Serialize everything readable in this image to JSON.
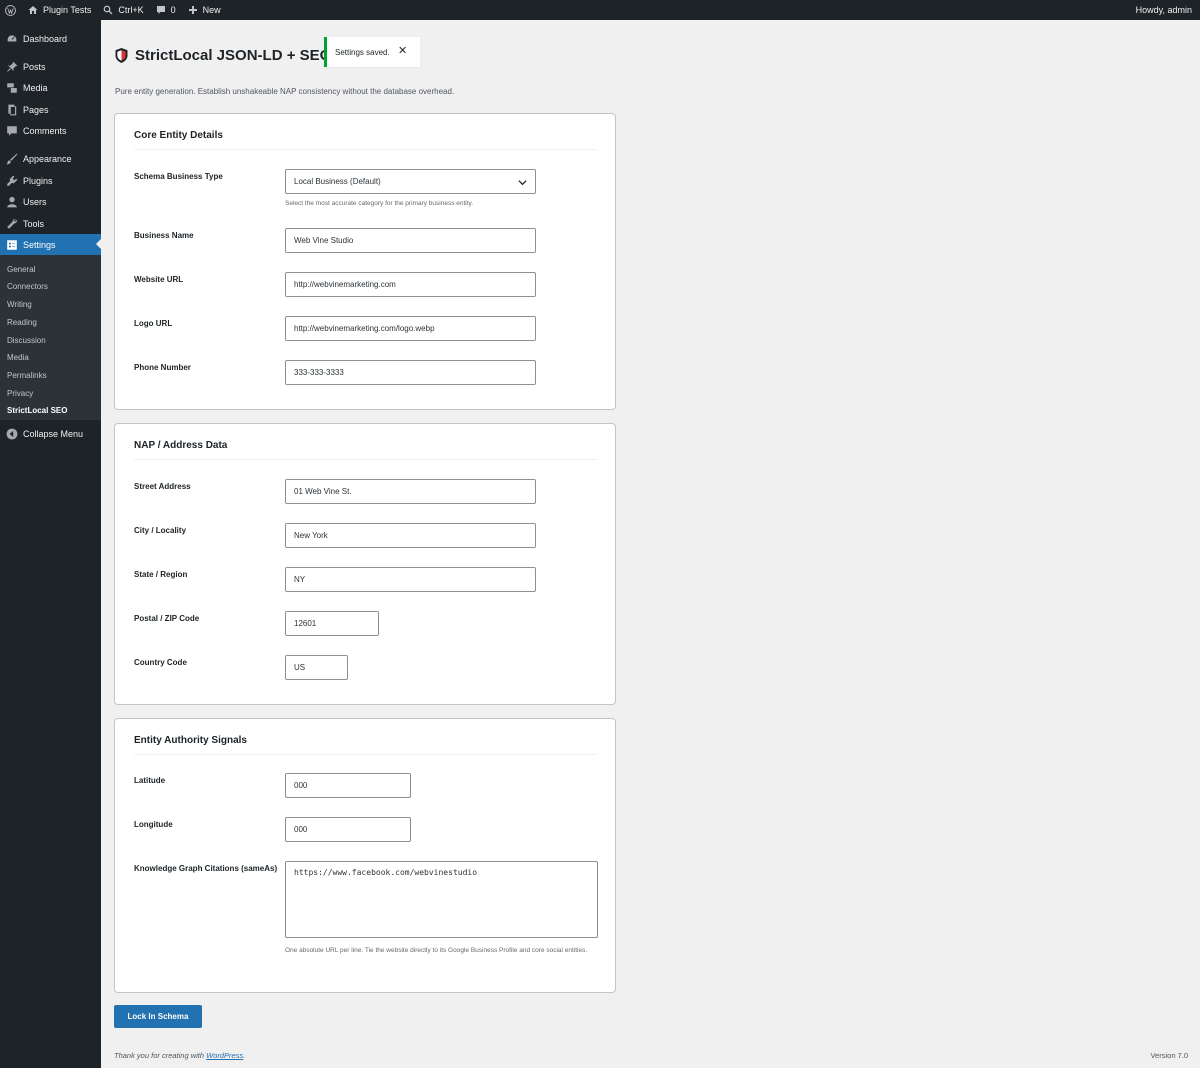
{
  "admin_bar": {
    "site_name": "Plugin Tests",
    "shortcut": "Ctrl+K",
    "comments_count": "0",
    "new_label": "New",
    "greeting": "Howdy, admin"
  },
  "sidebar": {
    "items": [
      {
        "label": "Dashboard",
        "icon": "dashboard-icon"
      },
      {
        "label": "Posts",
        "icon": "pin-icon"
      },
      {
        "label": "Media",
        "icon": "media-icon"
      },
      {
        "label": "Pages",
        "icon": "pages-icon"
      },
      {
        "label": "Comments",
        "icon": "comment-icon"
      },
      {
        "label": "Appearance",
        "icon": "brush-icon"
      },
      {
        "label": "Plugins",
        "icon": "plugin-icon"
      },
      {
        "label": "Users",
        "icon": "user-icon"
      },
      {
        "label": "Tools",
        "icon": "wrench-icon"
      },
      {
        "label": "Settings",
        "icon": "settings-icon"
      }
    ],
    "submenu": [
      "General",
      "Connectors",
      "Writing",
      "Reading",
      "Discussion",
      "Media",
      "Permalinks",
      "Privacy",
      "StrictLocal SEO"
    ],
    "collapse_label": "Collapse Menu"
  },
  "page": {
    "title": "StrictLocal JSON-LD + SEO",
    "notice": "Settings saved.",
    "description": "Pure entity generation. Establish unshakeable NAP consistency without the database overhead."
  },
  "core": {
    "title": "Core Entity Details",
    "schema_type_label": "Schema Business Type",
    "schema_type_value": "Local Business (Default)",
    "schema_type_help": "Select the most accurate category for the primary business entity.",
    "business_name_label": "Business Name",
    "business_name_value": "Web Vine Studio",
    "website_label": "Website URL",
    "website_value": "http://webvinemarketing.com",
    "logo_label": "Logo URL",
    "logo_value": "http://webvinemarketing.com/logo.webp",
    "phone_label": "Phone Number",
    "phone_value": "333-333-3333"
  },
  "nap": {
    "title": "NAP / Address Data",
    "street_label": "Street Address",
    "street_value": "01 Web Vine St.",
    "city_label": "City / Locality",
    "city_value": "New York",
    "state_label": "State / Region",
    "state_value": "NY",
    "zip_label": "Postal / ZIP Code",
    "zip_value": "12601",
    "country_label": "Country Code",
    "country_value": "US"
  },
  "authority": {
    "title": "Entity Authority Signals",
    "lat_label": "Latitude",
    "lat_value": "000",
    "lng_label": "Longitude",
    "lng_value": "000",
    "sameas_label": "Knowledge Graph Citations (sameAs)",
    "sameas_value": "https://www.facebook.com/webvinestudio",
    "sameas_help": "One absolute URL per line. Tie the website directly to its Google Business Profile and core social entities."
  },
  "submit_label": "Lock In Schema",
  "footer": {
    "thanks_prefix": "Thank you for creating with ",
    "thanks_link": "WordPress",
    "thanks_suffix": ".",
    "version": "Version 7.0"
  },
  "colors": {
    "accent": "#2271b1",
    "admin_bg": "#1d2327",
    "success": "#00a32a",
    "page_bg": "#f0f0f1"
  }
}
